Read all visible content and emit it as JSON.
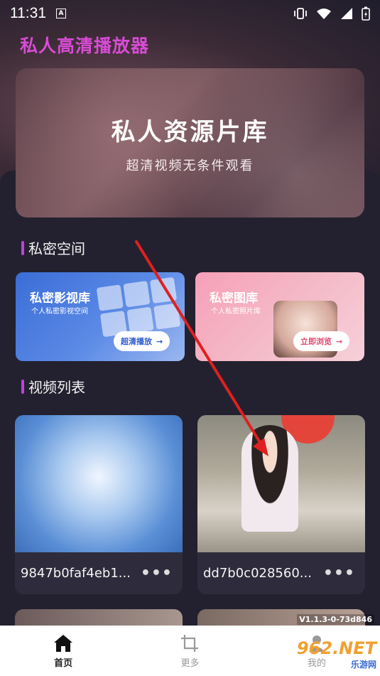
{
  "status_bar": {
    "time": "11:31",
    "a_badge": "A"
  },
  "app": {
    "title": "私人高清播放器"
  },
  "hero": {
    "title": "私人资源片库",
    "subtitle": "超清视频无条件观看"
  },
  "private_space": {
    "heading": "私密空间",
    "cards": [
      {
        "title": "私密影视库",
        "subtitle": "个人私密影视空间",
        "button": "超清播放"
      },
      {
        "title": "私密图库",
        "subtitle": "个人私密照片库",
        "button": "立即浏览"
      }
    ]
  },
  "video_list": {
    "heading": "视频列表",
    "items": [
      {
        "name": "9847b0faf4eb1..."
      },
      {
        "name": "dd7b0c028560..."
      }
    ],
    "more_glyph": "•••"
  },
  "version": "V1.1.3-0-73d846",
  "tabbar": {
    "tabs": [
      {
        "label": "首页",
        "icon": "home-icon",
        "active": true
      },
      {
        "label": "更多",
        "icon": "crop-icon",
        "active": false
      },
      {
        "label": "我的",
        "icon": "user-icon",
        "active": false
      }
    ]
  },
  "watermark": {
    "top": "962.NET",
    "bottom": "乐游网"
  },
  "colors": {
    "accent": "#c040e0",
    "title": "#d94bd6",
    "background": "#23212f",
    "annotation_arrow": "#e02020"
  }
}
